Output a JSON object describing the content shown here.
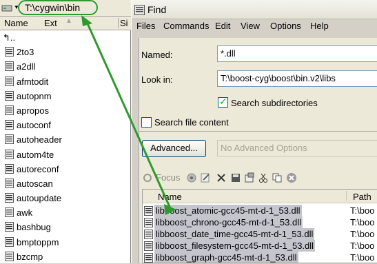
{
  "left_panel": {
    "path": "T:\\cygwin\\bin",
    "columns": {
      "name": "Name",
      "ext": "Ext",
      "size": "Si"
    },
    "parent_dir": "↰..",
    "files": [
      "2to3",
      "a2dll",
      "afmtodit",
      "autopnm",
      "apropos",
      "autoconf",
      "autoheader",
      "autom4te",
      "autoreconf",
      "autoscan",
      "autoupdate",
      "awk",
      "bashbug",
      "bmptoppm",
      "bzcmp"
    ]
  },
  "find_window": {
    "title": "Find",
    "menu": [
      "Files",
      "Commands",
      "Edit",
      "View",
      "Options",
      "Help"
    ],
    "named_label": "Named:",
    "named_value": "*.dll",
    "lookin_label": "Look in:",
    "lookin_value": "T:\\boost-cyg\\boost\\bin.v2\\libs",
    "search_subdirs_label": "Search subdirectories",
    "search_subdirs_checked": true,
    "search_content_label": "Search file content",
    "search_content_checked": false,
    "advanced_button": "Advanced...",
    "advanced_placeholder": "No Advanced Options",
    "toolbar": {
      "focus_label": "Focus"
    },
    "results": {
      "columns": {
        "name": "Name",
        "path": "Path"
      },
      "rows": [
        {
          "name": "libboost_atomic-gcc45-mt-d-1_53.dll",
          "path": "T:\\boo"
        },
        {
          "name": "libboost_chrono-gcc45-mt-d-1_53.dll",
          "path": "T:\\boo"
        },
        {
          "name": "libboost_date_time-gcc45-mt-d-1_53.dll",
          "path": "T:\\boo"
        },
        {
          "name": "libboost_filesystem-gcc45-mt-d-1_53.dll",
          "path": "T:\\boo"
        },
        {
          "name": "libboost_graph-gcc45-mt-d-1_53.dll",
          "path": "T:\\boo"
        }
      ]
    }
  },
  "colors": {
    "annotation_green": "#2e9a2e",
    "selection_bg": "#c5c5ce",
    "window_bg": "#ece9d8"
  }
}
